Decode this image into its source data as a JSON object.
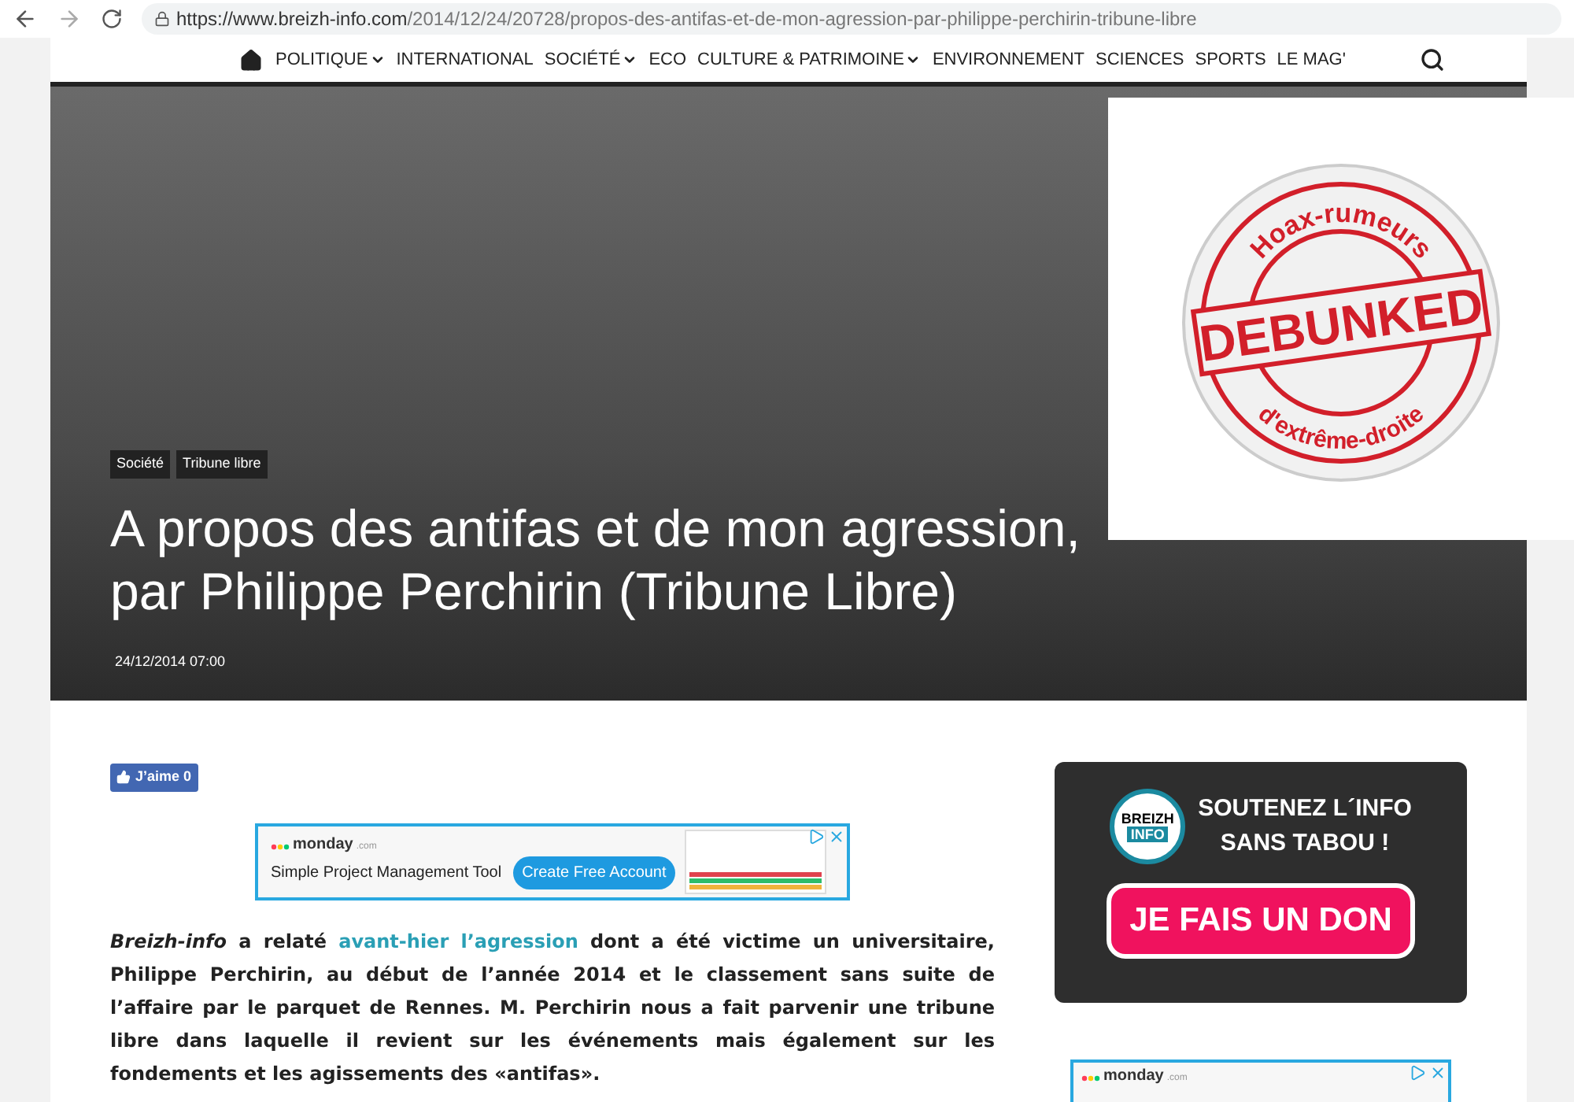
{
  "browser": {
    "url_host": "https://www.breizh-info.com",
    "url_path": "/2014/12/24/20728/propos-des-antifas-et-de-mon-agression-par-philippe-perchirin-tribune-libre"
  },
  "nav": {
    "items": [
      {
        "label": "POLITIQUE",
        "dropdown": true
      },
      {
        "label": "INTERNATIONAL",
        "dropdown": false
      },
      {
        "label": "SOCIÉTÉ",
        "dropdown": true
      },
      {
        "label": "ECO",
        "dropdown": false
      },
      {
        "label": "CULTURE & PATRIMOINE",
        "dropdown": true
      },
      {
        "label": "ENVIRONNEMENT",
        "dropdown": false
      },
      {
        "label": "SCIENCES",
        "dropdown": false
      },
      {
        "label": "SPORTS",
        "dropdown": false
      },
      {
        "label": "LE MAG'",
        "dropdown": false
      }
    ]
  },
  "hero": {
    "tags": [
      "Société",
      "Tribune libre"
    ],
    "title_lines": [
      "A propos des antifas et de mon agression,",
      "par Philippe Perchirin (Tribune Libre)"
    ],
    "date": "24/12/2014 07:00"
  },
  "sticker": {
    "top_text": "Hoax-rumeurs",
    "main_text": "DEBUNKED",
    "bottom_text": "d'extrême-droite"
  },
  "like_button": {
    "label": "J’aime 0"
  },
  "ad": {
    "brand": "monday",
    "brand_suffix": ".com",
    "headline": "Simple Project Management Tool",
    "cta": "Create Free Account"
  },
  "article": {
    "lead": "Breizh-info",
    "before_link": " a relaté ",
    "link": "avant-hier l’agression",
    "after_link": " dont a été victime un universitaire, Philippe Perchirin, au début de l’année 2014 et le classement sans suite de l’affaire par le parquet de Rennes. M. Perchirin nous a fait parvenir une tribune libre dans laquelle il revient sur les événements mais également sur les fondements et les agissements des «antifas»."
  },
  "donate": {
    "logo_top": "BREIZH",
    "logo_bottom": "INFO",
    "lines": [
      "SOUTENEZ L´INFO",
      "SANS TABOU !"
    ],
    "button": "JE FAIS UN DON"
  },
  "side_ad": {
    "brand": "monday",
    "brand_suffix": ".com"
  }
}
